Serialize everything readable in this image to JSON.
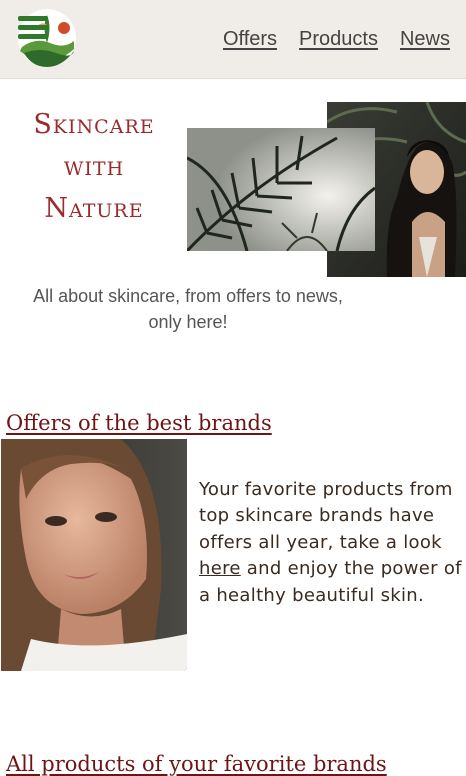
{
  "header": {
    "nav": [
      {
        "label": "Offers"
      },
      {
        "label": "Products"
      },
      {
        "label": "News"
      }
    ]
  },
  "hero": {
    "title_lines": [
      "Skincare",
      "with",
      "Nature"
    ],
    "tagline_line1": "All about skincare, from offers to news,",
    "tagline_line2": "only here!"
  },
  "offers": {
    "title": "Offers of the best brands",
    "text_before": "Your favorite products from top skincare brands have offers all year, take a look ",
    "link": "here",
    "text_after": " and enjoy the power of a healthy beautiful skin."
  },
  "products": {
    "title": "All products of your favorite brands"
  },
  "colors": {
    "header_bg": "#f0ede8",
    "title_red": "#9b2b2b",
    "section_title": "#6e1414",
    "burger_green": "#2d7a2d"
  },
  "icons": {
    "menu": "hamburger-icon",
    "logo": "nature-logo"
  }
}
